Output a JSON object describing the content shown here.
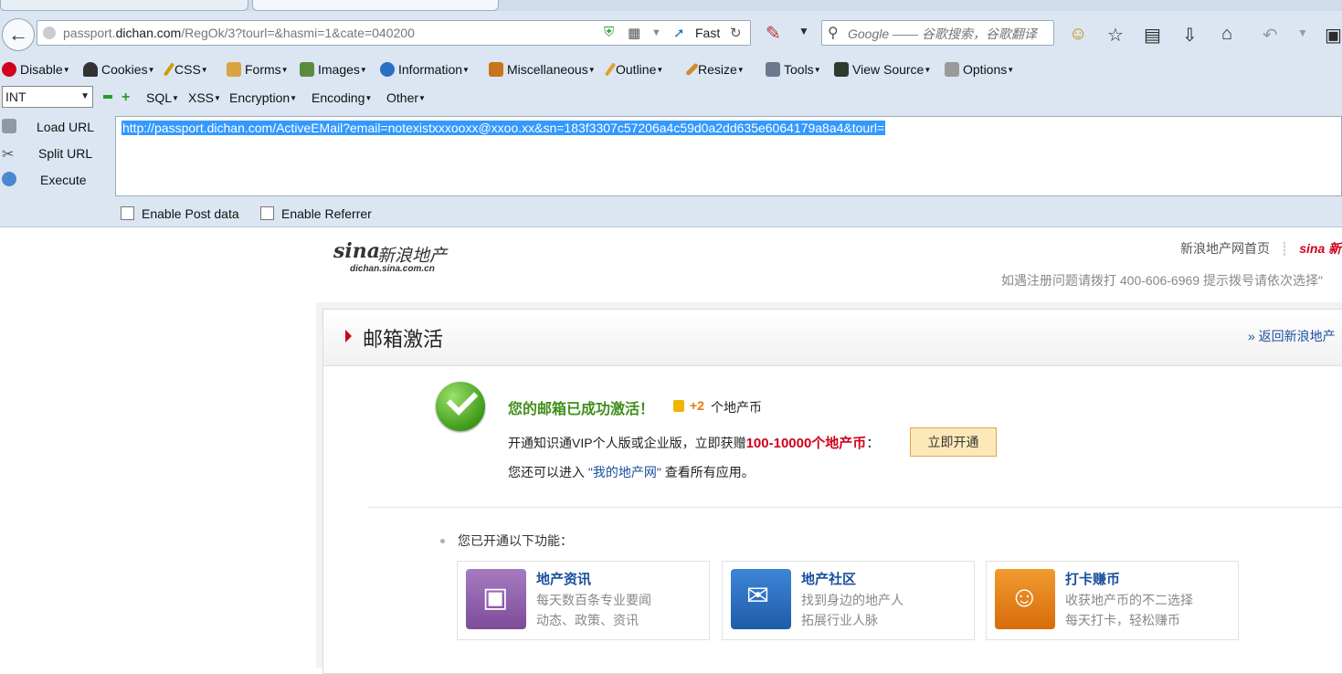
{
  "browser": {
    "address": {
      "url_prefix": "passport.",
      "url_domain": "dichan.com",
      "url_suffix": "/RegOk/3?tourl=&hasmi=1&cate=040200",
      "speed_label": "Fast"
    },
    "search": {
      "placeholder": "Google —— 谷歌搜索，谷歌翻译"
    }
  },
  "webdev_toolbar": {
    "items": [
      "Disable",
      "Cookies",
      "CSS",
      "Forms",
      "Images",
      "Information",
      "Miscellaneous",
      "Outline",
      "Resize",
      "Tools",
      "View Source",
      "Options"
    ]
  },
  "hackbar": {
    "select_value": "INT",
    "menus": [
      "SQL",
      "XSS",
      "Encryption",
      "Encoding",
      "Other"
    ],
    "actions": [
      "Load URL",
      "Split URL",
      "Execute"
    ],
    "url_value": "http://passport.dichan.com/ActiveEMail?email=notexistxxxooxx@xxoo.xx&sn=183f3307c57206a4c59d0a2dd635e6064179a8a4&tourl=",
    "checkboxes": [
      "Enable Post data",
      "Enable Referrer"
    ]
  },
  "page": {
    "logo_sina": "sina",
    "logo_cn": "新浪地产",
    "logo_domain": "dichan.sina.com.cn",
    "top_link": "新浪地产网首页",
    "top_link_sep": "┊",
    "top_link_logo": "sina 新",
    "hotline": "如遇注册问题请拨打 400-606-6969 提示拨号请依次选择\"",
    "title": "邮箱激活",
    "back_link": "» 返回新浪地产",
    "success": "您的邮箱已成功激活！",
    "coin_plus": "+2",
    "coin_unit": "个地产币",
    "vip_before": "开通知识通VIP个人版或企业版，立即获赠",
    "vip_highlight": "100-10000个地产币",
    "vip_after": "：",
    "open_button": "立即开通",
    "mysite_before": "您还可以进入 ",
    "mysite_link": "\"我的地产网\"",
    "mysite_after": " 查看所有应用。",
    "features_label": "您已开通以下功能：",
    "features": [
      {
        "title": "地产资讯",
        "line1": "每天数百条专业要闻",
        "line2": "动态、政策、资讯",
        "color": "#8e5aa8"
      },
      {
        "title": "地产社区",
        "line1": "找到身边的地产人",
        "line2": "拓展行业人脉",
        "color": "#2b6fc4"
      },
      {
        "title": "打卡赚币",
        "line1": "收获地产币的不二选择",
        "line2": "每天打卡，轻松赚币",
        "color": "#e37d12"
      }
    ]
  }
}
